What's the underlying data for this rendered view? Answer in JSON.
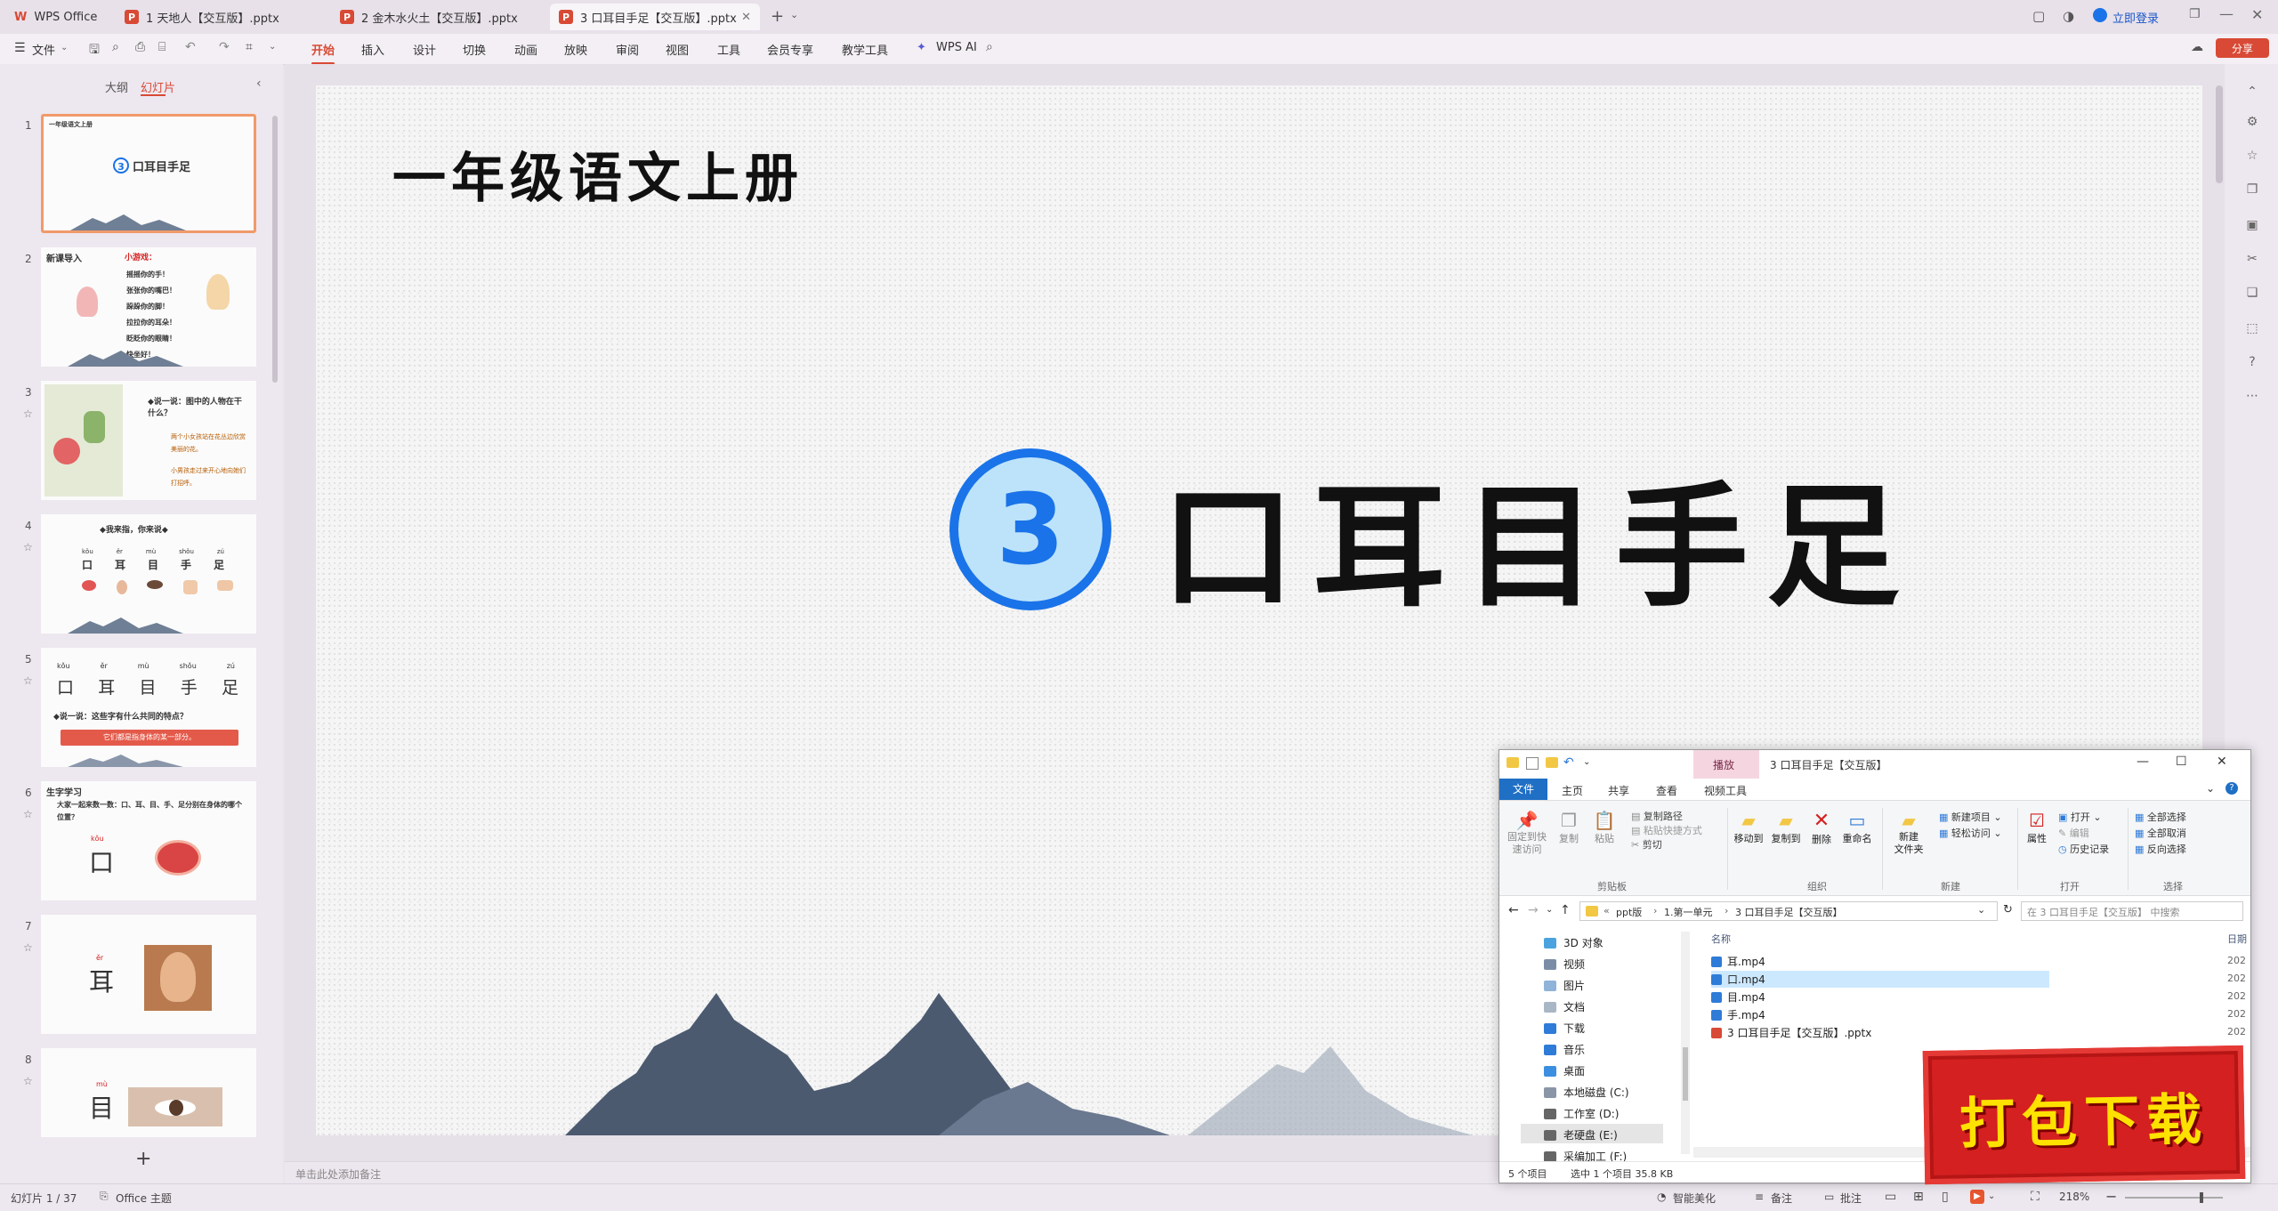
{
  "titlebar": {
    "app_tab": "WPS Office",
    "doc_tabs": [
      {
        "label": "1 天地人【交互版】.pptx"
      },
      {
        "label": "2 金木水火土【交互版】.pptx"
      },
      {
        "label": "3 口耳目手足【交互版】.pptx"
      }
    ],
    "login": "立即登录"
  },
  "menubar": {
    "file": "文件",
    "tabs": [
      "开始",
      "插入",
      "设计",
      "切换",
      "动画",
      "放映",
      "审阅",
      "视图",
      "工具",
      "会员专享",
      "教学工具"
    ],
    "wps_ai": "WPS AI",
    "share": "分享"
  },
  "leftpanel": {
    "tab_outline": "大纲",
    "tab_slides": "幻灯片",
    "thumbs": {
      "t1": {
        "header": "一年级语文上册",
        "num": "3",
        "title": "口耳目手足"
      },
      "t2": {
        "heading": "新课导入",
        "game": "小游戏：",
        "lines": [
          "摇摇你的手！",
          "张张你的嘴巴！",
          "跺跺你的脚！",
          "拉拉你的耳朵！",
          "眨眨你的眼睛！",
          "快坐好！"
        ]
      },
      "t3": {
        "q": "◆说一说：图中的人物在干什么？",
        "a1": "两个小女孩站在花丛边欣赏美丽的花。",
        "a2": "小男孩走过来开心地向她们打招呼。"
      },
      "t4": {
        "title": "◆我来指，你来说◆",
        "pinyin": [
          "kǒu",
          "ěr",
          "mù",
          "shǒu",
          "zú"
        ],
        "chars": [
          "口",
          "耳",
          "目",
          "手",
          "足"
        ]
      },
      "t5": {
        "pinyin": [
          "kǒu",
          "ěr",
          "mù",
          "shǒu",
          "zú"
        ],
        "chars": [
          "口",
          "耳",
          "目",
          "手",
          "足"
        ],
        "q": "◆说一说：这些字有什么共同的特点？",
        "a": "它们都是指身体的某一部分。"
      },
      "t6": {
        "heading": "生字学习",
        "q": "大家一起来数一数：口、耳、目、手、足分别在身体的哪个位置？",
        "pinyin": "kǒu",
        "char": "口"
      },
      "t7": {
        "pinyin": "ěr",
        "char": "耳"
      },
      "t8": {
        "pinyin": "mù",
        "char": "目"
      }
    },
    "add": "+"
  },
  "slide": {
    "header": "一年级语文上册",
    "lesson_num": "3",
    "title": "口耳目手足"
  },
  "notes_placeholder": "单击此处添加备注",
  "statusbar": {
    "slide_info": "幻灯片 1 / 37",
    "theme": "Office 主题",
    "smart": "智能美化",
    "notes": "备注",
    "comments": "批注",
    "zoom": "218%"
  },
  "explorer": {
    "title": "3 口耳目手足【交互版】",
    "context_tab": "播放",
    "tabs": [
      "文件",
      "主页",
      "共享",
      "查看",
      "视频工具"
    ],
    "ribbon": {
      "pin": "固定到快\n速访问",
      "copy": "复制",
      "paste": "粘贴",
      "copy_path": "复制路径",
      "paste_shortcut": "粘贴快捷方式",
      "cut": "剪切",
      "group_clipboard": "剪贴板",
      "move_to": "移动到",
      "copy_to": "复制到",
      "delete": "删除",
      "rename": "重命名",
      "group_organize": "组织",
      "new_folder": "新建\n文件夹",
      "new_item": "新建项目",
      "easy_access": "轻松访问",
      "group_new": "新建",
      "properties": "属性",
      "open": "打开",
      "edit": "编辑",
      "history": "历史记录",
      "group_open": "打开",
      "select_all": "全部选择",
      "select_none": "全部取消",
      "invert": "反向选择",
      "group_select": "选择"
    },
    "address": [
      "ppt版",
      "1.第一单元",
      "3 口耳目手足【交互版】"
    ],
    "search_placeholder": "在 3 口耳目手足【交互版】 中搜索",
    "nav": [
      "3D 对象",
      "视频",
      "图片",
      "文档",
      "下载",
      "音乐",
      "桌面",
      "本地磁盘 (C:)",
      "工作室 (D:)",
      "老硬盘 (E:)",
      "采编加工 (F:)"
    ],
    "col_name": "名称",
    "col_date": "日期",
    "files": [
      "耳.mp4",
      "口.mp4",
      "目.mp4",
      "手.mp4",
      "3 口耳目手足【交互版】.pptx"
    ],
    "date_short": "202",
    "status_count": "5 个项目",
    "status_selected": "选中 1 个项目  35.8 KB"
  },
  "badge": {
    "text": "打包下载"
  },
  "colors": {
    "accent": "#d84a35",
    "blue": "#1a73e8"
  }
}
